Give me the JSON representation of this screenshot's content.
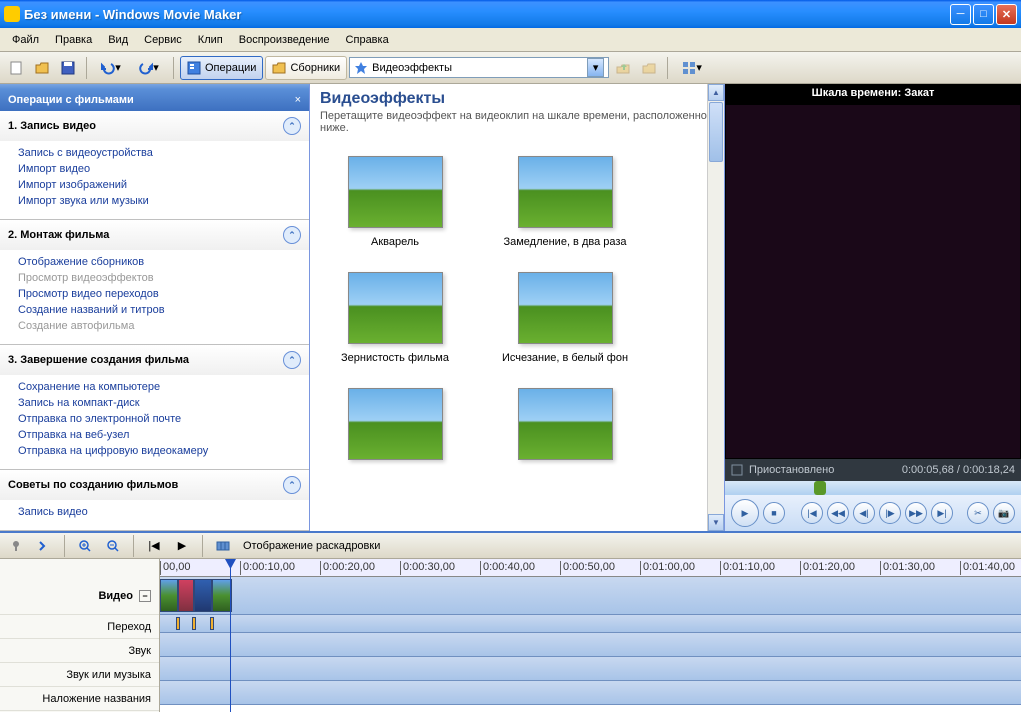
{
  "titlebar": {
    "text": "Без имени - Windows Movie Maker"
  },
  "menu": [
    "Файл",
    "Правка",
    "Вид",
    "Сервис",
    "Клип",
    "Воспроизведение",
    "Справка"
  ],
  "toolbar": {
    "tasks_label": "Операции",
    "collections_label": "Сборники",
    "location": "Видеоэффекты"
  },
  "task_pane": {
    "header": "Операции с фильмами",
    "sections": [
      {
        "title": "1. Запись видео",
        "links": [
          {
            "t": "Запись с видеоустройства",
            "d": false
          },
          {
            "t": "Импорт видео",
            "d": false
          },
          {
            "t": "Импорт изображений",
            "d": false
          },
          {
            "t": "Импорт звука или музыки",
            "d": false
          }
        ]
      },
      {
        "title": "2. Монтаж фильма",
        "links": [
          {
            "t": "Отображение сборников",
            "d": false
          },
          {
            "t": "Просмотр видеоэффектов",
            "d": true
          },
          {
            "t": "Просмотр видео переходов",
            "d": false
          },
          {
            "t": "Создание названий и титров",
            "d": false
          },
          {
            "t": "Создание автофильма",
            "d": true
          }
        ]
      },
      {
        "title": "3. Завершение создания фильма",
        "links": [
          {
            "t": "Сохранение на компьютере",
            "d": false
          },
          {
            "t": "Запись на компакт-диск",
            "d": false
          },
          {
            "t": "Отправка по электронной почте",
            "d": false
          },
          {
            "t": "Отправка на веб-узел",
            "d": false
          },
          {
            "t": "Отправка на цифровую видеокамеру",
            "d": false
          }
        ]
      },
      {
        "title": "Советы по созданию фильмов",
        "links": [
          {
            "t": "Запись видео",
            "d": false
          }
        ]
      }
    ]
  },
  "content": {
    "title": "Видеоэффекты",
    "subtitle": "Перетащите видеоэффект на видеоклип на шкале времени, расположенной ниже.",
    "effects": [
      "Акварель",
      "Замедление, в два раза",
      "Зернистость фильма",
      "Исчезание, в белый фон",
      "",
      ""
    ]
  },
  "preview": {
    "title": "Шкала времени: Закат",
    "status": "Приостановлено",
    "time_current": "0:00:05,68",
    "time_total": "0:00:18,24"
  },
  "timeline": {
    "storyboard_label": "Отображение раскадровки",
    "tracks": [
      "Видео",
      "Переход",
      "Звук",
      "Звук или музыка",
      "Наложение названия"
    ],
    "ticks": [
      "00,00",
      "0:00:10,00",
      "0:00:20,00",
      "0:00:30,00",
      "0:00:40,00",
      "0:00:50,00",
      "0:01:00,00",
      "0:01:10,00",
      "0:01:20,00",
      "0:01:30,00",
      "0:01:40,00"
    ]
  }
}
